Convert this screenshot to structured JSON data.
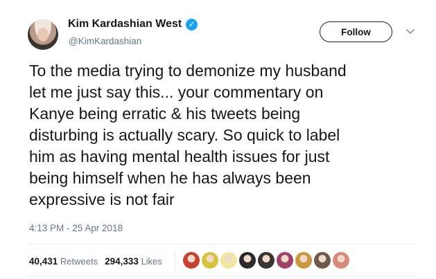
{
  "author": {
    "name": "Kim Kardashian West",
    "handle": "@KimKardashian",
    "verified_icon": "verified-badge-icon"
  },
  "follow_button": {
    "label": "Follow"
  },
  "more_menu": {
    "icon": "chevron-down-icon"
  },
  "tweet": {
    "text": "To the media trying to demonize my husband\nlet me just say this... your commentary on\nKanye being erratic & his tweets being\ndisturbing is actually scary. So quick to label\nhim as having mental health issues for just\nbeing himself when he has always been\nexpressive is not fair",
    "timestamp": "4:13 PM - 25 Apr 2018"
  },
  "stats": {
    "retweets_count": "40,431",
    "retweets_label": "Retweets",
    "likes_count": "294,333",
    "likes_label": "Likes"
  },
  "colors": {
    "link_blue": "#1da1f2",
    "muted_text": "#657786",
    "text": "#14171a"
  },
  "likers": [
    {
      "name": "liker-avatar-1",
      "color": "#c9412f"
    },
    {
      "name": "liker-avatar-2",
      "color": "#d9c23b"
    },
    {
      "name": "liker-avatar-3",
      "color": "#f1e7a0"
    },
    {
      "name": "liker-avatar-4",
      "color": "#2b2b2b"
    },
    {
      "name": "liker-avatar-5",
      "color": "#3a3330"
    },
    {
      "name": "liker-avatar-6",
      "color": "#a0416b"
    },
    {
      "name": "liker-avatar-7",
      "color": "#c99a3c"
    },
    {
      "name": "liker-avatar-8",
      "color": "#6f5a4a"
    },
    {
      "name": "liker-avatar-9",
      "color": "#d88a7a"
    }
  ]
}
